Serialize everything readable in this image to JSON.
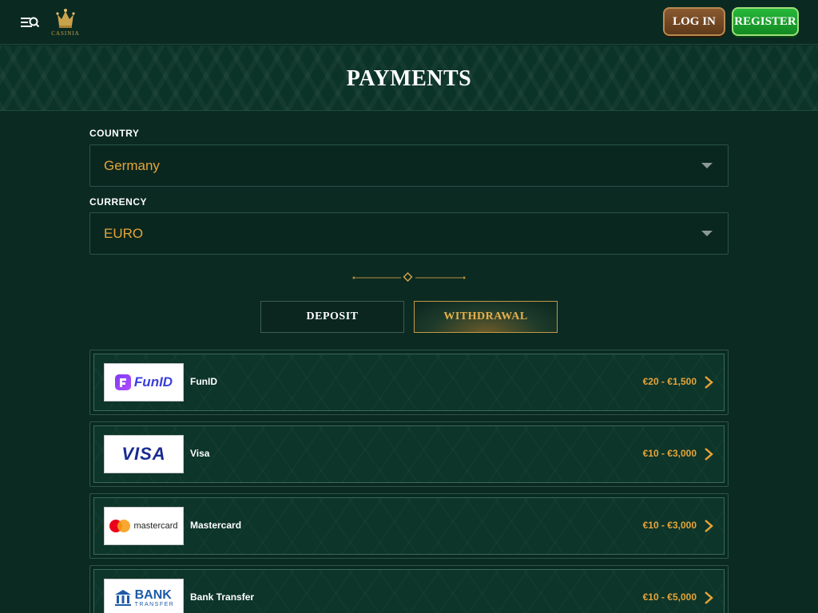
{
  "header": {
    "logo_text": "CASINIA",
    "login_label": "LOG IN",
    "register_label": "REGISTER"
  },
  "page": {
    "title": "PAYMENTS"
  },
  "country": {
    "label": "COUNTRY",
    "value": "Germany"
  },
  "currency": {
    "label": "CURRENCY",
    "value": "EURO"
  },
  "tabs": {
    "deposit_label": "DEPOSIT",
    "withdrawal_label": "WITHDRAWAL",
    "active": "WITHDRAWAL"
  },
  "payments": [
    {
      "name": "FunID",
      "range": "€20 - €1,500",
      "logo_text": "FunID",
      "logo_icon": "funid-logo"
    },
    {
      "name": "Visa",
      "range": "€10 - €3,000",
      "logo_text": "VISA",
      "logo_icon": "visa-logo"
    },
    {
      "name": "Mastercard",
      "range": "€10 - €3,000",
      "logo_text": "mastercard",
      "logo_icon": "mastercard-logo"
    },
    {
      "name": "Bank Transfer",
      "range": "€10 - €5,000",
      "logo_text": "BANK",
      "logo_subtext": "TRANSFER",
      "logo_icon": "bank-logo"
    }
  ],
  "colors": {
    "background": "#0b2a22",
    "accent_gold": "#e6a43a",
    "login_brown": "#7a4c24",
    "register_green": "#1fa330"
  },
  "icons": {
    "menu": "menu-search-icon",
    "logo": "crown-logo-icon",
    "caret": "chevron-down-icon",
    "row_arrow": "chevron-right-icon",
    "ornament": "diamond-divider-icon"
  }
}
